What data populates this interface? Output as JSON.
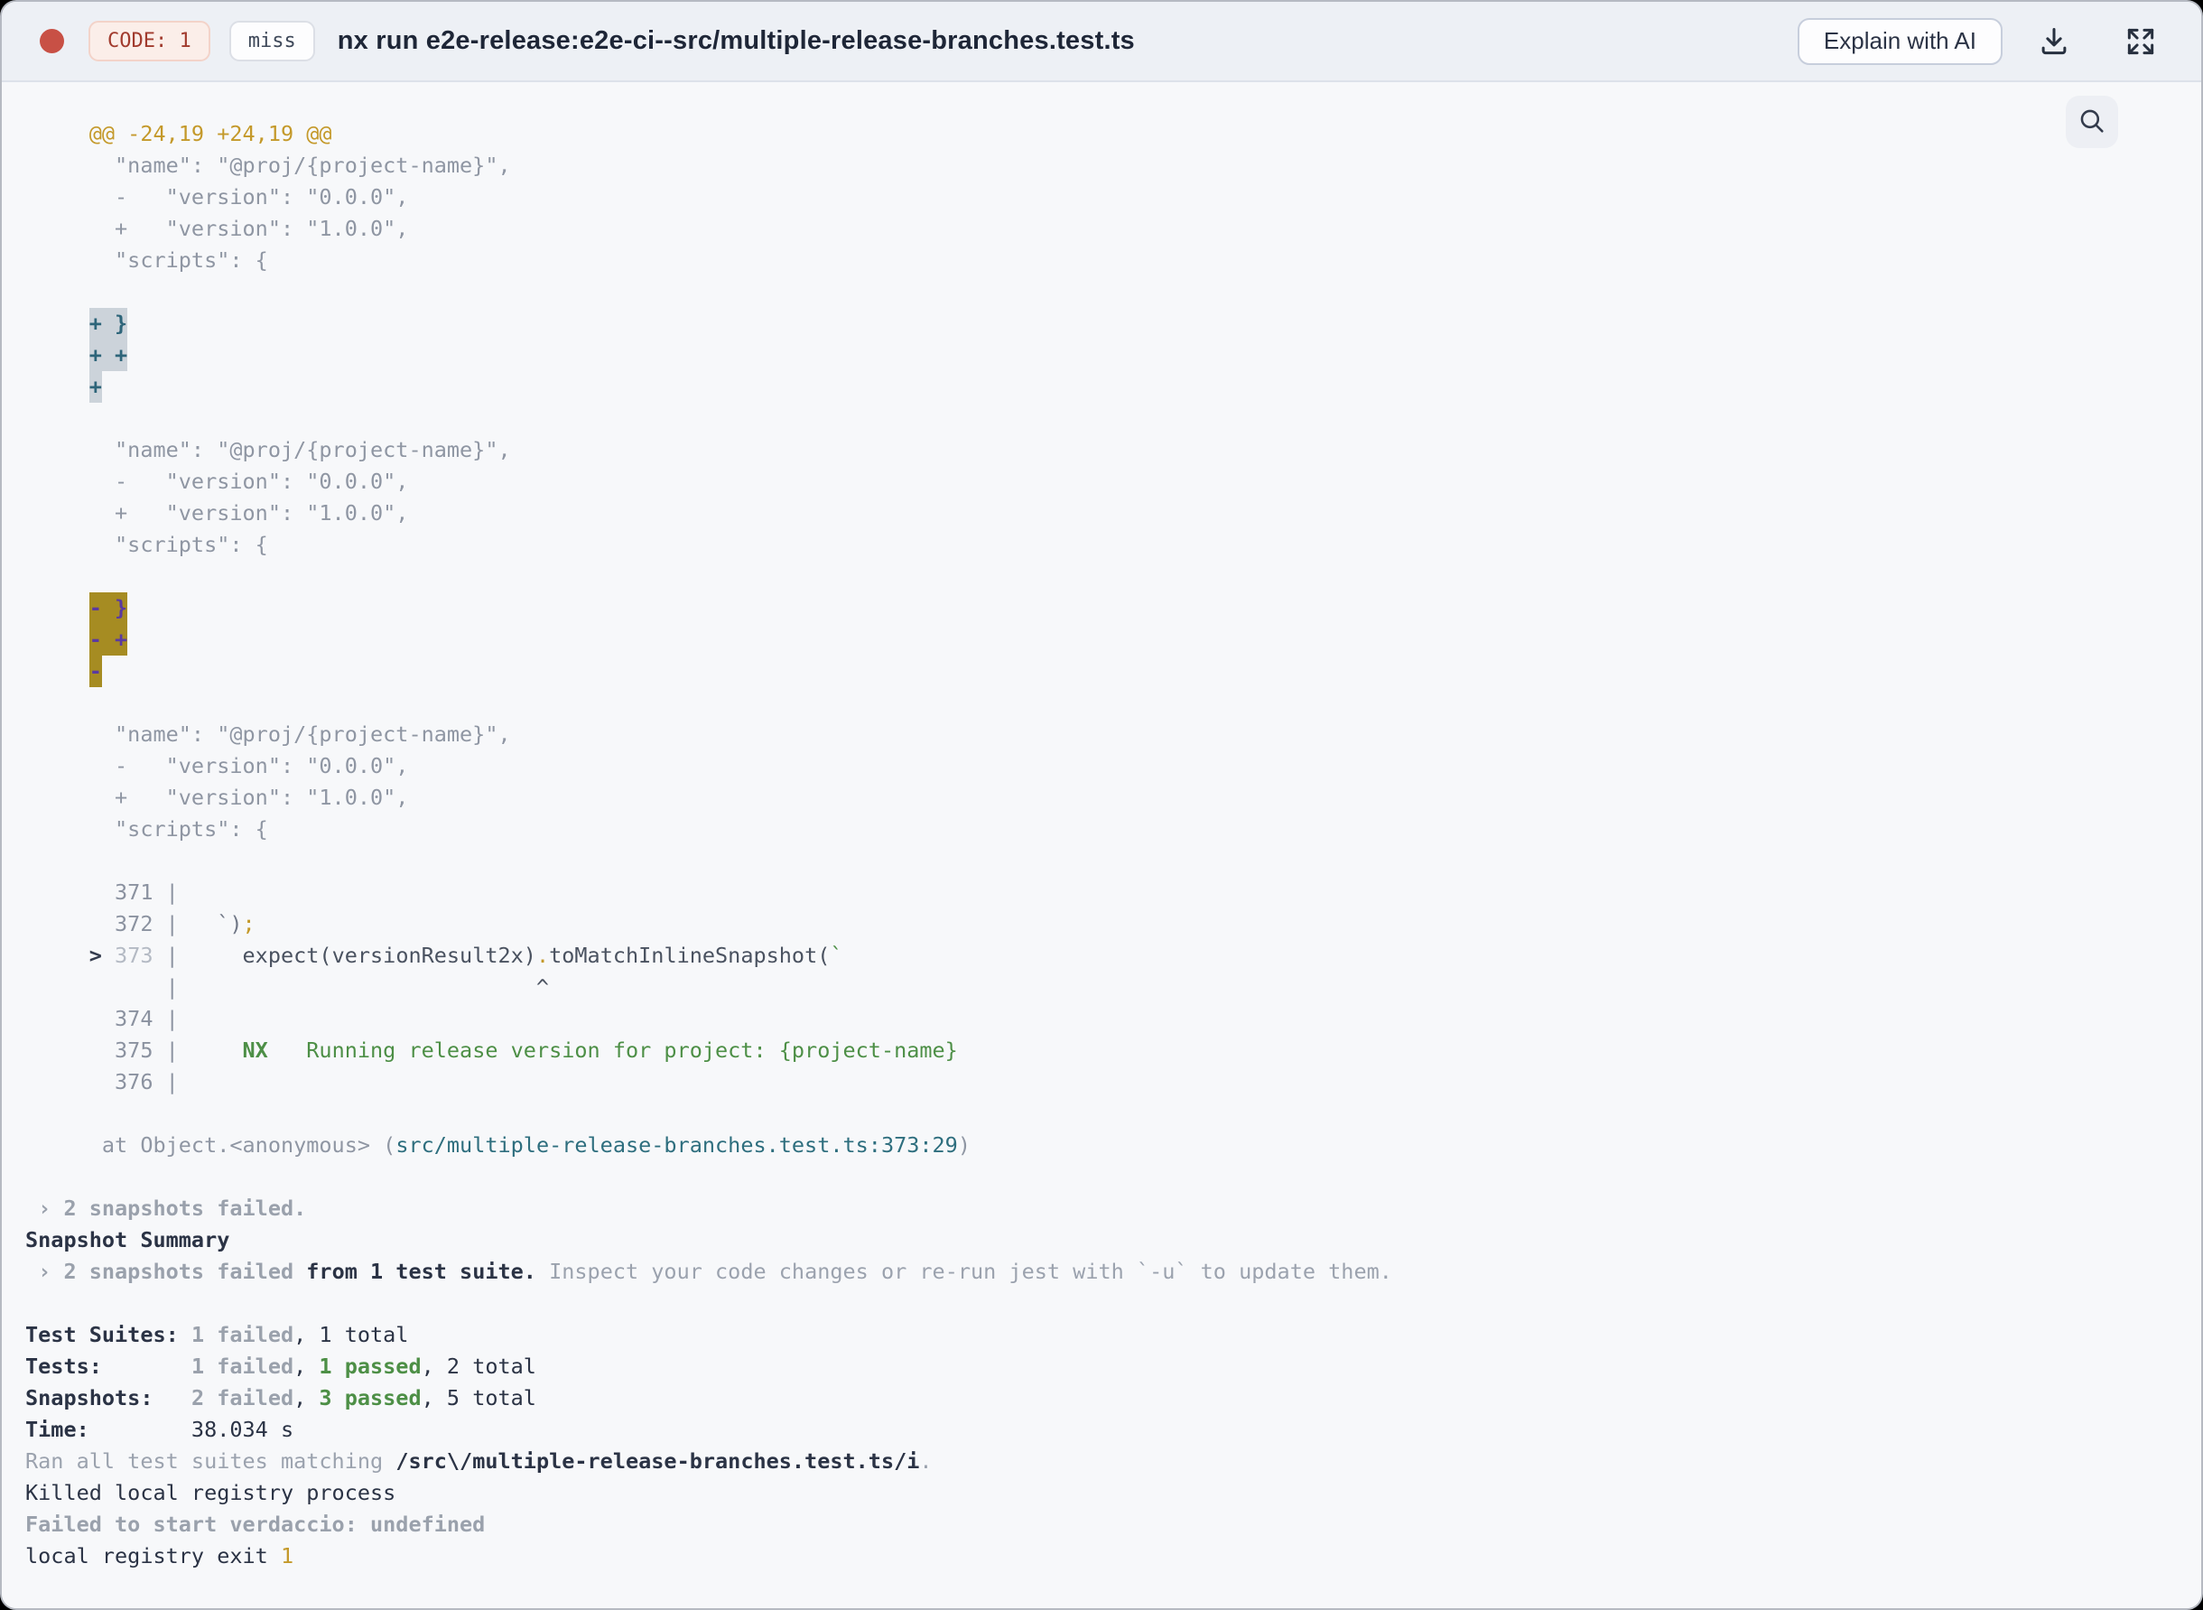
{
  "header": {
    "code_badge": "CODE: 1",
    "cache_badge": "miss",
    "title": "nx run e2e-release:e2e-ci--src/multiple-release-branches.test.ts",
    "explain_button": "Explain with AI"
  },
  "colors": {
    "status_dot": "#c85045",
    "code_badge_text": "#a13b2e",
    "hunk_yellow": "#c4992a",
    "diff_addition_highlight_bg": "#ccd3da",
    "diff_addition_highlight_text": "#2e657a",
    "diff_deletion_highlight_bg": "#a68c22",
    "diff_deletion_highlight_text": "#5b3aa0",
    "pass_green": "#4d8f46",
    "file_path_teal": "#2e6e7e",
    "header_bg": "#edf0f5",
    "terminal_bg": "#f7f8fa"
  },
  "terminal": {
    "lines": [
      [
        {
          "t": "     @@ -24,19 +24,19 @@",
          "s": "hunk"
        }
      ],
      [
        {
          "t": "       \"name\": \"@proj/{project-name}\",",
          "s": "muted"
        }
      ],
      [
        {
          "t": "       -   \"version\": \"0.0.0\",",
          "s": "muted"
        }
      ],
      [
        {
          "t": "       +   \"version\": \"1.0.0\",",
          "s": "muted"
        }
      ],
      [
        {
          "t": "       \"scripts\": {",
          "s": "muted"
        }
      ],
      [],
      [
        {
          "t": "     ",
          "s": "muted"
        },
        {
          "t": "+ }",
          "s": "addhl"
        }
      ],
      [
        {
          "t": "     ",
          "s": "muted"
        },
        {
          "t": "+ +",
          "s": "addhl"
        }
      ],
      [
        {
          "t": "     ",
          "s": "muted"
        },
        {
          "t": "+",
          "s": "addhl"
        }
      ],
      [],
      [
        {
          "t": "       \"name\": \"@proj/{project-name}\",",
          "s": "muted"
        }
      ],
      [
        {
          "t": "       -   \"version\": \"0.0.0\",",
          "s": "muted"
        }
      ],
      [
        {
          "t": "       +   \"version\": \"1.0.0\",",
          "s": "muted"
        }
      ],
      [
        {
          "t": "       \"scripts\": {",
          "s": "muted"
        }
      ],
      [],
      [
        {
          "t": "     ",
          "s": "muted"
        },
        {
          "t": "- }",
          "s": "delhl"
        }
      ],
      [
        {
          "t": "     ",
          "s": "muted"
        },
        {
          "t": "- +",
          "s": "delhl"
        }
      ],
      [
        {
          "t": "     ",
          "s": "muted"
        },
        {
          "t": "-",
          "s": "delhl"
        }
      ],
      [],
      [
        {
          "t": "       \"name\": \"@proj/{project-name}\",",
          "s": "muted"
        }
      ],
      [
        {
          "t": "       -   \"version\": \"0.0.0\",",
          "s": "muted"
        }
      ],
      [
        {
          "t": "       +   \"version\": \"1.0.0\",",
          "s": "muted"
        }
      ],
      [
        {
          "t": "       \"scripts\": {",
          "s": "muted"
        }
      ],
      [],
      [
        {
          "t": "       371 |",
          "s": "lineno"
        }
      ],
      [
        {
          "t": "       372 |",
          "s": "lineno"
        },
        {
          "t": "   `)",
          "s": "gray2"
        },
        {
          "t": ";",
          "s": "yellow"
        }
      ],
      [
        {
          "t": "     > ",
          "s": "marker"
        },
        {
          "t": "373 ",
          "s": "linenoL"
        },
        {
          "t": "|",
          "s": "lineno"
        },
        {
          "t": "     expect(versionResult2x)",
          "s": "code"
        },
        {
          "t": ".",
          "s": "yellow"
        },
        {
          "t": "toMatchInlineSnapshot(",
          "s": "code"
        },
        {
          "t": "`",
          "s": "green"
        }
      ],
      [
        {
          "t": "           |",
          "s": "lineno"
        },
        {
          "t": "                            ^",
          "s": "code"
        }
      ],
      [
        {
          "t": "       374 |",
          "s": "lineno"
        }
      ],
      [
        {
          "t": "       375 |",
          "s": "lineno"
        },
        {
          "t": "     NX",
          "s": "greenB"
        },
        {
          "t": "   Running release version for project: {project-name}",
          "s": "green"
        }
      ],
      [
        {
          "t": "       376 |",
          "s": "lineno"
        }
      ],
      [],
      [
        {
          "t": "      at Object.<anonymous> (",
          "s": "muted"
        },
        {
          "t": "src/multiple-release-branches.test.ts:373:29",
          "s": "teal"
        },
        {
          "t": ")",
          "s": "muted"
        }
      ],
      [],
      [
        {
          "t": " › 2 snapshots failed.",
          "s": "grayB"
        }
      ],
      [
        {
          "t": "Snapshot Summary",
          "s": "darkB"
        }
      ],
      [
        {
          "t": " › 2 snapshots failed",
          "s": "grayB"
        },
        {
          "t": " from 1 test suite.",
          "s": "darkB"
        },
        {
          "t": " Inspect your code changes or re-run jest with `-u` to update them.",
          "s": "grayL"
        }
      ],
      [],
      [
        {
          "t": "Test Suites: ",
          "s": "darkB"
        },
        {
          "t": "1 failed",
          "s": "grayB"
        },
        {
          "t": ", 1 total",
          "s": "dark"
        }
      ],
      [
        {
          "t": "Tests:",
          "s": "darkB"
        },
        {
          "t": "       ",
          "s": "dark"
        },
        {
          "t": "1 failed",
          "s": "grayB"
        },
        {
          "t": ", ",
          "s": "dark"
        },
        {
          "t": "1 passed",
          "s": "greenB"
        },
        {
          "t": ", 2 total",
          "s": "dark"
        }
      ],
      [
        {
          "t": "Snapshots:",
          "s": "darkB"
        },
        {
          "t": "   ",
          "s": "dark"
        },
        {
          "t": "2 failed",
          "s": "grayB"
        },
        {
          "t": ", ",
          "s": "dark"
        },
        {
          "t": "3 passed",
          "s": "greenB"
        },
        {
          "t": ", 5 total",
          "s": "dark"
        }
      ],
      [
        {
          "t": "Time:",
          "s": "darkB"
        },
        {
          "t": "        38.034 s",
          "s": "dark"
        }
      ],
      [
        {
          "t": "Ran all test suites matching ",
          "s": "grayL"
        },
        {
          "t": "/src\\/multiple-release-branches.test.ts/i",
          "s": "darkB"
        },
        {
          "t": ".",
          "s": "grayL"
        }
      ],
      [
        {
          "t": "Killed local registry process",
          "s": "dark"
        }
      ],
      [
        {
          "t": "Failed to start verdaccio: undefined",
          "s": "grayB"
        }
      ],
      [
        {
          "t": "local registry exit ",
          "s": "dark"
        },
        {
          "t": "1",
          "s": "yellow"
        }
      ]
    ]
  }
}
